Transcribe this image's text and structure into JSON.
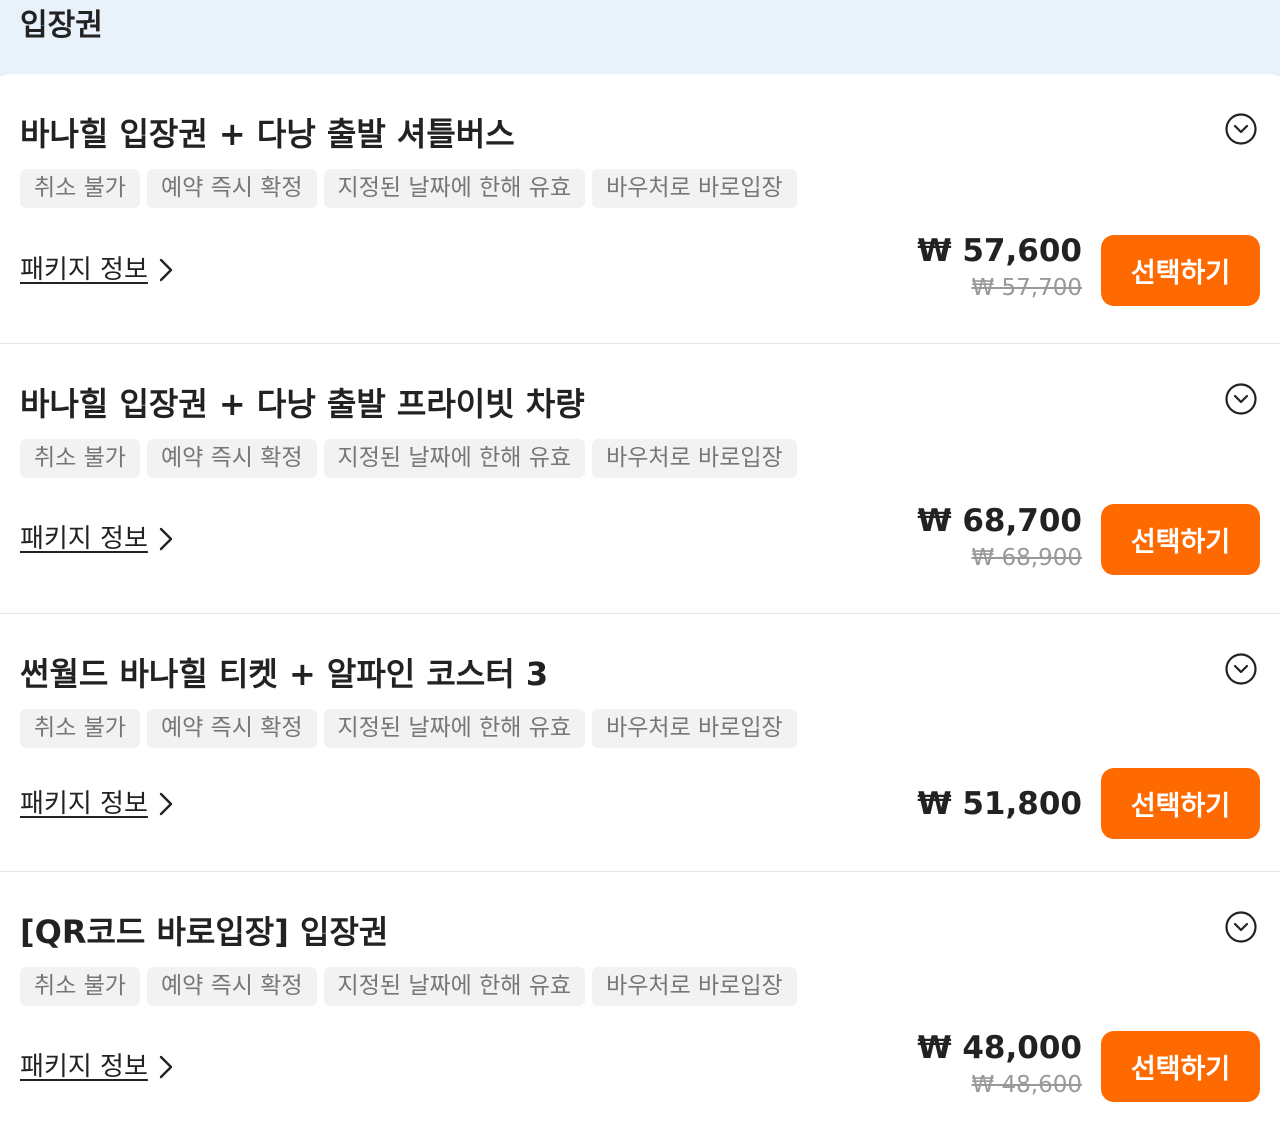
{
  "section": {
    "title": "입장권"
  },
  "packages": [
    {
      "title": "바나힐 입장권 + 다낭 출발 셔틀버스",
      "tags": [
        "취소 불가",
        "예약 즉시 확정",
        "지정된 날짜에 한해 유효",
        "바우처로 바로입장"
      ],
      "info_label": "패키지 정보",
      "price": "₩ 57,600",
      "original_price": "₩ 57,700",
      "button_label": "선택하기"
    },
    {
      "title": "바나힐 입장권 + 다낭 출발 프라이빗 차량",
      "tags": [
        "취소 불가",
        "예약 즉시 확정",
        "지정된 날짜에 한해 유효",
        "바우처로 바로입장"
      ],
      "info_label": "패키지 정보",
      "price": "₩ 68,700",
      "original_price": "₩ 68,900",
      "button_label": "선택하기"
    },
    {
      "title": "썬월드 바나힐 티켓 + 알파인 코스터 3",
      "tags": [
        "취소 불가",
        "예약 즉시 확정",
        "지정된 날짜에 한해 유효",
        "바우처로 바로입장"
      ],
      "info_label": "패키지 정보",
      "price": "₩ 51,800",
      "original_price": "",
      "button_label": "선택하기"
    },
    {
      "title": "[QR코드 바로입장] 입장권",
      "tags": [
        "취소 불가",
        "예약 즉시 확정",
        "지정된 날짜에 한해 유효",
        "바우처로 바로입장"
      ],
      "info_label": "패키지 정보",
      "price": "₩ 48,000",
      "original_price": "₩ 48,600",
      "button_label": "선택하기"
    }
  ],
  "colors": {
    "accent": "#ff6a00",
    "header_bg": "#e9f1fb",
    "tag_bg": "#f2f2f2"
  },
  "icons": {
    "expand": "chevron-down-circle-icon",
    "info_arrow": "chevron-right-icon"
  }
}
